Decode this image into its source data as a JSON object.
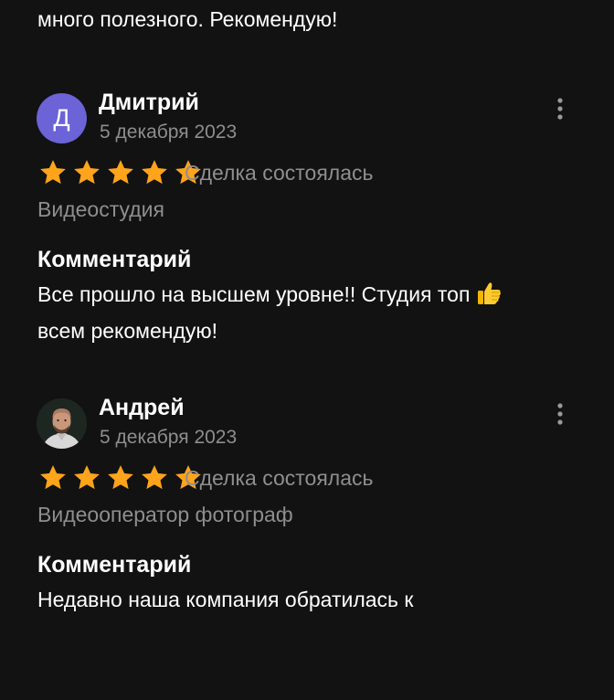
{
  "top_text": "много полезного. Рекомендую!",
  "reviews": [
    {
      "name": "Дмитрий",
      "avatar_letter": "Д",
      "avatar_color": "#6b63d6",
      "date": "5 декабря 2023",
      "rating": 5,
      "deal_status": "Сделка состоялась",
      "category": "Видеостудия",
      "comment_title": "Комментарий",
      "comment_lines": [
        "Все прошло на высшем уровне!! Студия топ",
        "всем рекомендую!"
      ],
      "comment_emoji": "thumbs-up-emoji"
    },
    {
      "name": "Андрей",
      "avatar": "profile-photo",
      "date": "5 декабря 2023",
      "rating": 5,
      "deal_status": "Сделка состоялась",
      "category": "Видеооператор фотограф",
      "comment_title": "Комментарий",
      "comment_lines": [
        "Недавно наша компания обратилась к"
      ]
    }
  ],
  "colors": {
    "background": "#121212",
    "star": "#ffa41b",
    "secondary_text": "#8e8e8e"
  },
  "icons": {
    "more": "more-vertical-icon",
    "star": "star-icon"
  }
}
